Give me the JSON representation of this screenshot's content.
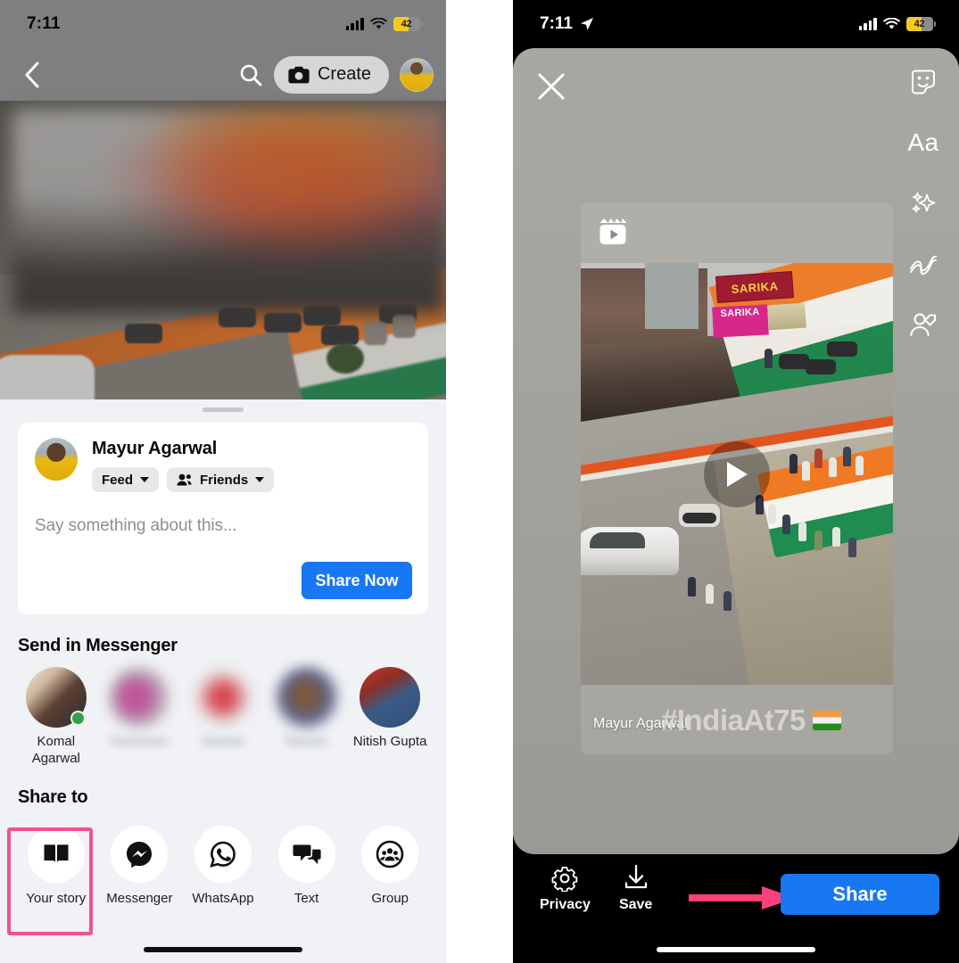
{
  "left_panel": {
    "status_bar": {
      "time": "7:11",
      "battery_percent": "42",
      "signal_icon": "cellular-signal-icon",
      "wifi_icon": "wifi-icon",
      "battery_icon": "battery-icon"
    },
    "nav": {
      "back_icon": "back-chevron-icon",
      "search_icon": "search-icon",
      "create_label": "Create",
      "create_icon": "camera-icon",
      "avatar": "profile-avatar"
    },
    "compose": {
      "author": "Mayur Agarwal",
      "destination_pill": "Feed",
      "audience_pill": "Friends",
      "audience_icon": "friends-icon",
      "composer_placeholder": "Say something about this...",
      "share_now_label": "Share Now"
    },
    "messenger_section": {
      "title": "Send in Messenger",
      "contacts": [
        {
          "name": "Komal\nAgarwal",
          "blurred": false,
          "online": true
        },
        {
          "name": "",
          "blurred": true,
          "online": false
        },
        {
          "name": "",
          "blurred": true,
          "online": false
        },
        {
          "name": "",
          "blurred": true,
          "online": false
        },
        {
          "name": "Nitish Gupta",
          "blurred": false,
          "online": false
        }
      ]
    },
    "share_to_section": {
      "title": "Share to",
      "items": [
        {
          "label": "Your story",
          "icon": "book-story-icon",
          "highlighted": true
        },
        {
          "label": "Messenger",
          "icon": "messenger-icon",
          "highlighted": false
        },
        {
          "label": "WhatsApp",
          "icon": "whatsapp-icon",
          "highlighted": false
        },
        {
          "label": "Text",
          "icon": "chat-bubbles-icon",
          "highlighted": false
        },
        {
          "label": "Group",
          "icon": "group-people-icon",
          "highlighted": false
        }
      ]
    }
  },
  "right_panel": {
    "status_bar": {
      "time": "7:11",
      "battery_percent": "42",
      "location_icon": "location-arrow-icon"
    },
    "editor": {
      "close_icon": "close-x-icon",
      "tools": [
        {
          "icon": "sticker-icon",
          "name": "sticker-tool"
        },
        {
          "icon": "text-aa-icon",
          "name": "text-tool",
          "label": "Aa"
        },
        {
          "icon": "sparkles-effects-icon",
          "name": "effects-tool"
        },
        {
          "icon": "draw-squiggle-icon",
          "name": "draw-tool"
        },
        {
          "icon": "tag-person-icon",
          "name": "tag-people-tool"
        }
      ],
      "media": {
        "reels_badge_icon": "reels-clapperboard-icon",
        "play_icon": "play-triangle-icon",
        "caption_author": "Mayur Agarwal",
        "caption_hashtag": "#IndiaAt75",
        "caption_emoji": "india-flag-emoji",
        "scene_signs": [
          "SARIKA",
          "SARIKA"
        ]
      }
    },
    "bottom_bar": {
      "privacy_label": "Privacy",
      "privacy_icon": "gear-icon",
      "save_label": "Save",
      "save_icon": "download-arrow-icon",
      "share_label": "Share",
      "annotation_arrow": "pink-arrow-annotation"
    }
  },
  "colors": {
    "facebook_blue": "#1877f2",
    "highlight_pink": "#f4508f",
    "arrow_pink": "#fa4178",
    "battery_yellow": "#f6c91f",
    "online_green": "#31a24c",
    "sheet_bg": "#f0f2f5"
  }
}
